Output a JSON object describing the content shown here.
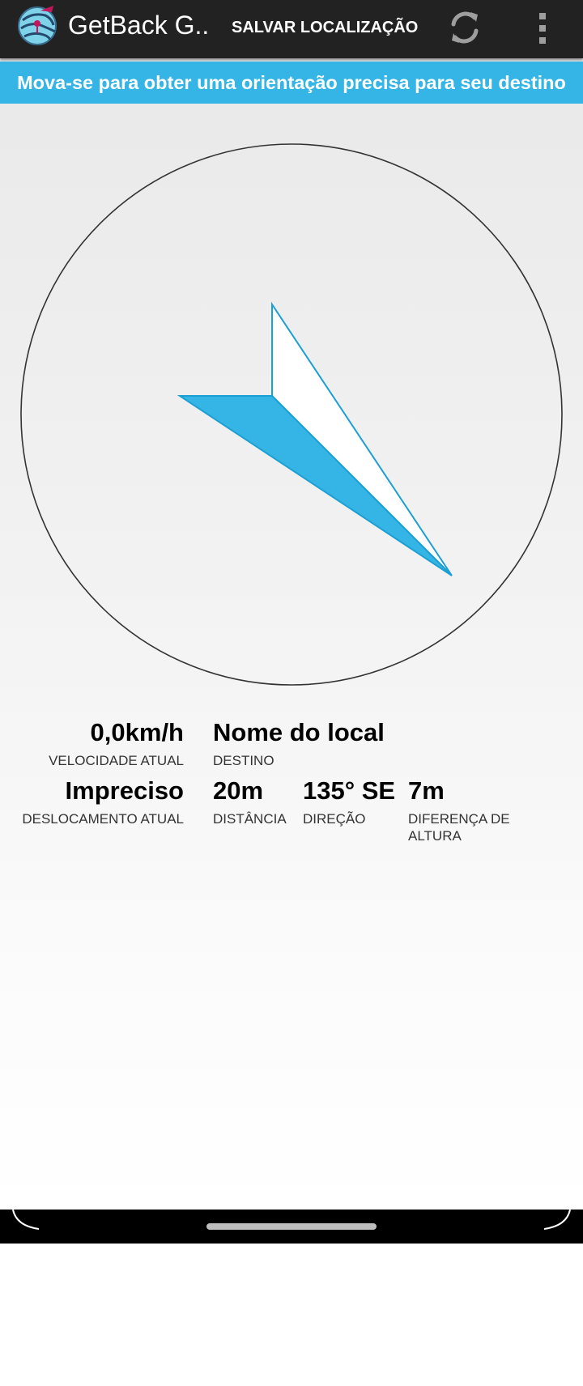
{
  "app": {
    "title": "GetBack G...",
    "icon": "app-logo-icon"
  },
  "toolbar": {
    "save_label": "SALVAR LOCALIZAÇÃO",
    "refresh_icon": "refresh-icon",
    "overflow_icon": "more-vert-icon"
  },
  "banner": {
    "text": "Mova-se para obter uma orientação precisa para seu destino"
  },
  "compass": {
    "bearing_degrees": 135,
    "accent_color": "#35b5e5",
    "ring_color": "#333333"
  },
  "stats": {
    "speed": {
      "value": "0,0km/h",
      "label": "VELOCIDADE ATUAL"
    },
    "destination": {
      "value": "Nome do local",
      "label": "DESTINO"
    },
    "movement": {
      "value": "Impreciso",
      "label": "DESLOCAMENTO ATUAL"
    },
    "distance": {
      "value": "20m",
      "label": "DISTÂNCIA"
    },
    "direction": {
      "value": "135° SE",
      "label": "DIREÇÃO"
    },
    "altitude_diff": {
      "value": "7m",
      "label": "DIFERENÇA DE ALTURA"
    }
  }
}
